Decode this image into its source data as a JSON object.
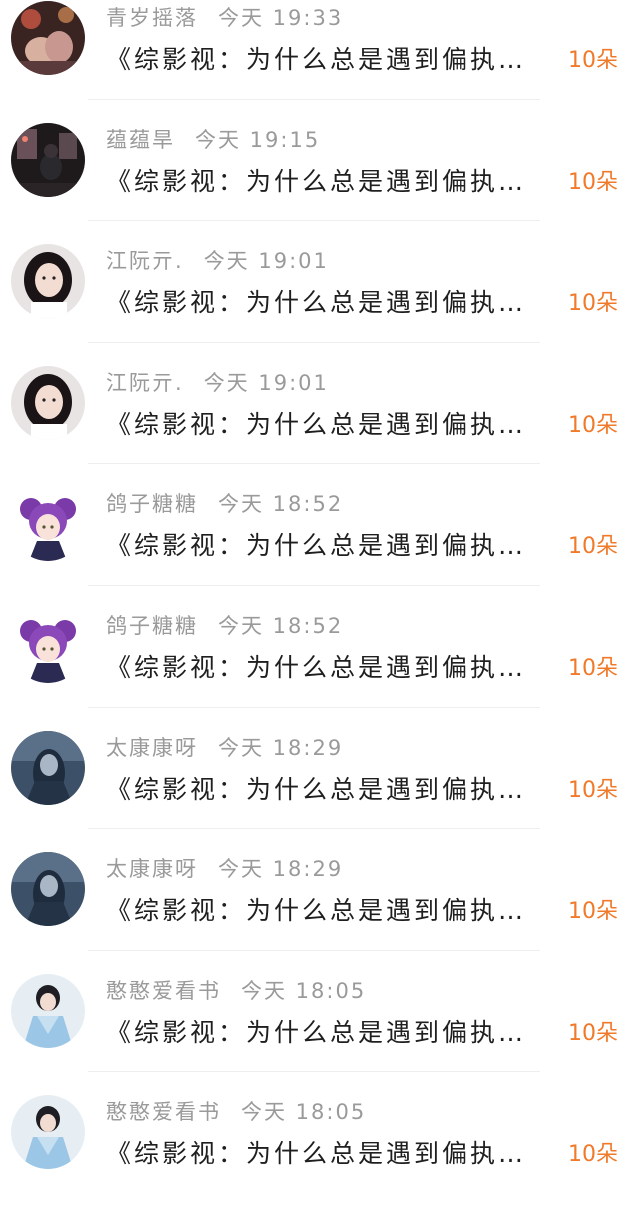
{
  "gift_list": {
    "items": [
      {
        "name": "青岁摇落",
        "time": "今天 19:33",
        "message": "《综影视：为什么总是遇到偏执…",
        "gift": "10朵",
        "avatar_icon": "avatar-couple-hands"
      },
      {
        "name": "蕴蕴旱",
        "time": "今天 19:15",
        "message": "《综影视：为什么总是遇到偏执…",
        "gift": "10朵",
        "avatar_icon": "avatar-night-street"
      },
      {
        "name": "江阮亓.",
        "time": "今天 19:01",
        "message": "《综影视：为什么总是遇到偏执…",
        "gift": "10朵",
        "avatar_icon": "avatar-girl-dark-hair"
      },
      {
        "name": "江阮亓.",
        "time": "今天 19:01",
        "message": "《综影视：为什么总是遇到偏执…",
        "gift": "10朵",
        "avatar_icon": "avatar-girl-dark-hair"
      },
      {
        "name": "鸽子糖糖",
        "time": "今天 18:52",
        "message": "《综影视：为什么总是遇到偏执…",
        "gift": "10朵",
        "avatar_icon": "avatar-anime-purple-hair"
      },
      {
        "name": "鸽子糖糖",
        "time": "今天 18:52",
        "message": "《综影视：为什么总是遇到偏执…",
        "gift": "10朵",
        "avatar_icon": "avatar-anime-purple-hair"
      },
      {
        "name": "太康康呀",
        "time": "今天 18:29",
        "message": "《综影视：为什么总是遇到偏执…",
        "gift": "10朵",
        "avatar_icon": "avatar-anime-blue-night"
      },
      {
        "name": "太康康呀",
        "time": "今天 18:29",
        "message": "《综影视：为什么总是遇到偏执…",
        "gift": "10朵",
        "avatar_icon": "avatar-anime-blue-night"
      },
      {
        "name": "憨憨爱看书",
        "time": "今天 18:05",
        "message": "《综影视：为什么总是遇到偏执…",
        "gift": "10朵",
        "avatar_icon": "avatar-woman-blue-dress"
      },
      {
        "name": "憨憨爱看书",
        "time": "今天 18:05",
        "message": "《综影视：为什么总是遇到偏执…",
        "gift": "10朵",
        "avatar_icon": "avatar-woman-blue-dress"
      }
    ]
  },
  "colors": {
    "name_gray": "#9a9a9a",
    "message_text": "#1f1f1f",
    "gift_orange": "#f07a2a"
  }
}
